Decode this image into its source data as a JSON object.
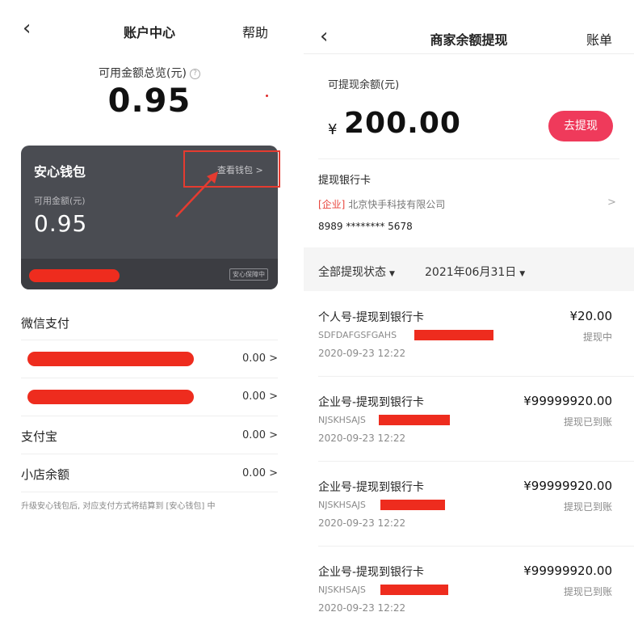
{
  "left": {
    "nav": {
      "back_icon": "chevron-left-icon",
      "title": "账户中心",
      "help": "帮助"
    },
    "total": {
      "label": "可用金额总览(元)",
      "help_icon": "question-circle-icon",
      "amount": "0.95"
    },
    "wallet_card": {
      "title": "安心钱包",
      "view_link": "查看钱包 >",
      "balance_label": "可用金额(元)",
      "balance": "0.95",
      "guarantee_badge": "安心保障中"
    },
    "wechat": {
      "label": "微信支付",
      "rows": [
        {
          "value": "0.00 >"
        },
        {
          "value": "0.00 >"
        }
      ]
    },
    "alipay": {
      "label": "支付宝",
      "value": "0.00 >"
    },
    "shop": {
      "label": "小店余额",
      "value": "0.00 >"
    },
    "footnote": "升级安心钱包后, 对应支付方式将结算到 [安心钱包] 中",
    "colors": {
      "annotation_red": "#e53b30",
      "card_bg": "#4a4c52"
    }
  },
  "right": {
    "nav": {
      "back_icon": "chevron-left-icon",
      "title": "商家余额提现",
      "bill": "账单"
    },
    "withdrawable": {
      "label": "可提现余额(元)",
      "currency": "¥",
      "amount": "200.00"
    },
    "withdraw_button": "去提现",
    "bank": {
      "title": "提现银行卡",
      "company_tag": "[企业]",
      "company_name": "北京快手科技有限公司",
      "card_number": "8989 ******** 5678",
      "chevron": ">"
    },
    "filters": {
      "status": "全部提现状态",
      "date": "2021年06月31日"
    },
    "records": [
      {
        "title": "个人号-提现到银行卡",
        "amount": "¥20.00",
        "id": "SDFDAFGSFGAHS",
        "status": "提现中",
        "time": "2020-09-23 12:22"
      },
      {
        "title": "企业号-提现到银行卡",
        "amount": "¥99999920.00",
        "id": "NJSKHSAJS",
        "status": "提现已到账",
        "time": "2020-09-23 12:22"
      },
      {
        "title": "企业号-提现到银行卡",
        "amount": "¥99999920.00",
        "id": "NJSKHSAJS",
        "status": "提现已到账",
        "time": "2020-09-23 12:22"
      },
      {
        "title": "企业号-提现到银行卡",
        "amount": "¥99999920.00",
        "id": "NJSKHSAJS",
        "status": "提现已到账",
        "time": "2020-09-23 12:22"
      }
    ],
    "colors": {
      "accent": "#ef3a5b",
      "tag_red": "#e8433b"
    }
  }
}
